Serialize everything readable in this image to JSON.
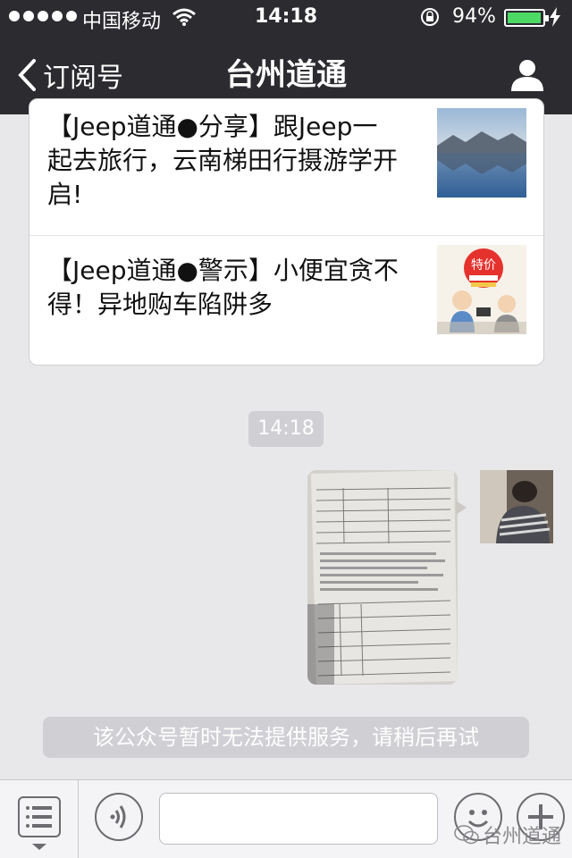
{
  "status": {
    "carrier": "中国移动",
    "time": "14:18",
    "battery_percent": "94%",
    "battery_level": 0.94
  },
  "nav": {
    "back_label": "订阅号",
    "title": "台州道通"
  },
  "articles": [
    {
      "title": "【Jeep道通●分享】跟Jeep一起去旅行，云南梯田行摄游学开启!",
      "thumb_icon": "landscape-photo"
    },
    {
      "title": "【Jeep道通●警示】小便宜贪不得！异地购车陷阱多",
      "thumb_icon": "cartoon-illustration",
      "thumb_text": "特价"
    }
  ],
  "chat": {
    "timestamp": "14:18",
    "system_message": "该公众号暂时无法提供服务，请稍后再试"
  },
  "inputbar": {
    "placeholder": ""
  },
  "watermark": "台州道通",
  "colors": {
    "nav_bg": "#2b2b30",
    "battery": "#4cd964",
    "chat_bg": "#e8e8ea"
  }
}
